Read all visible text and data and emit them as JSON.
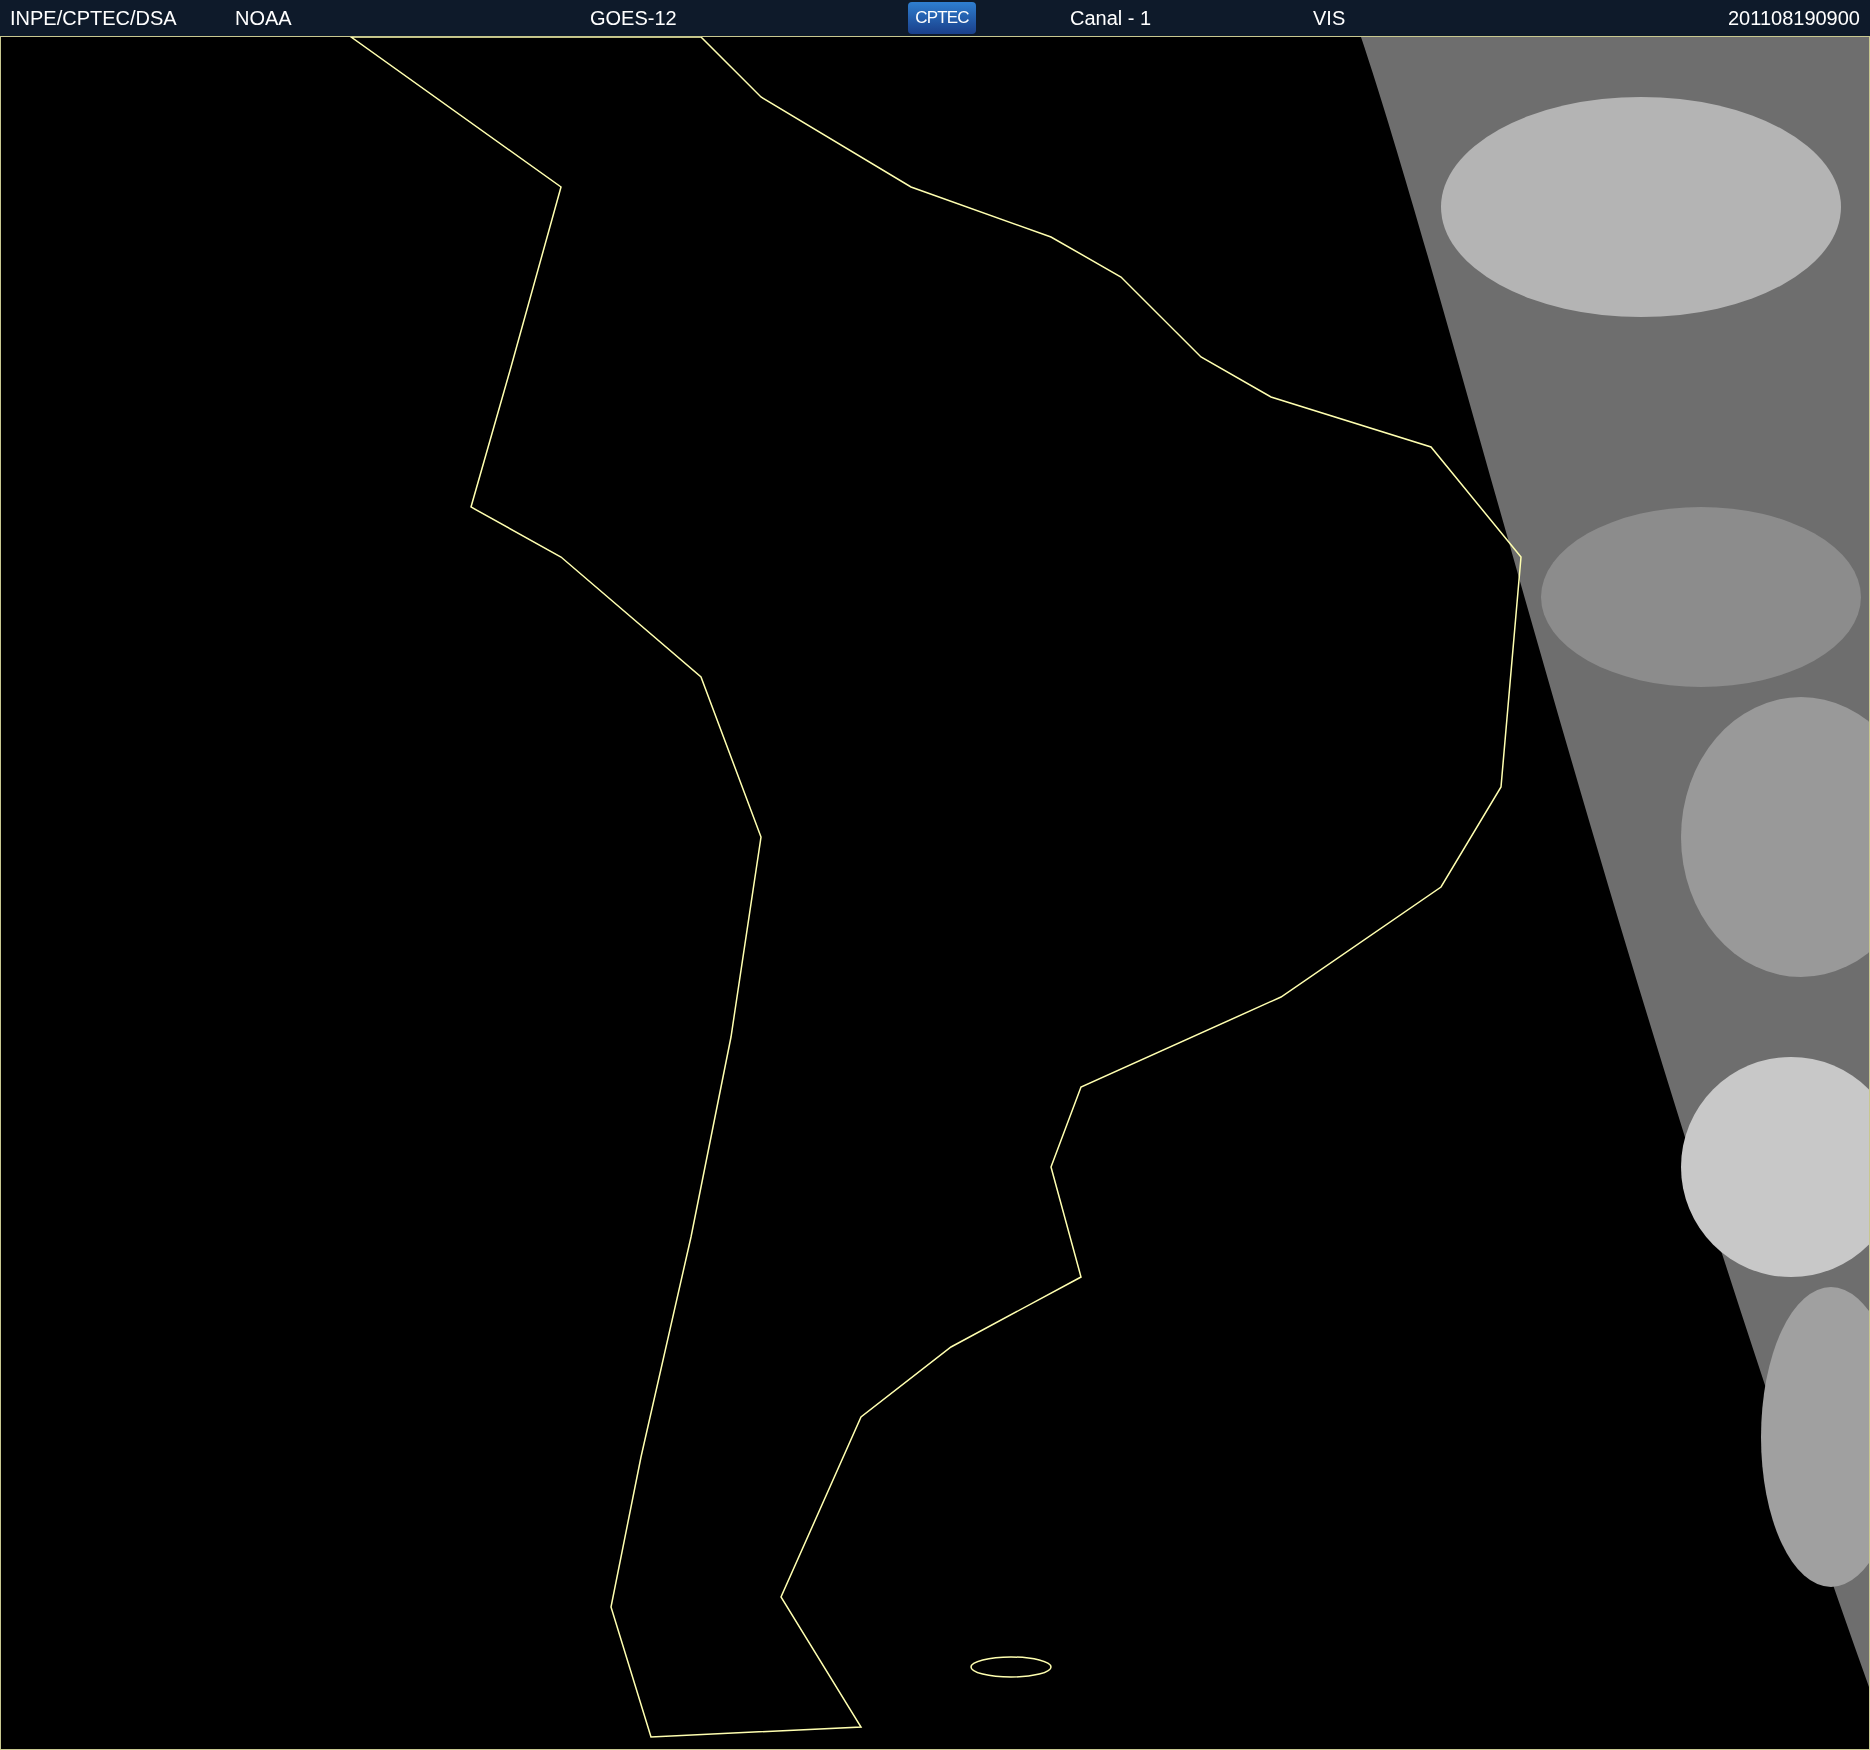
{
  "header": {
    "items": [
      {
        "kind": "text",
        "text": "INPE/CPTEC/DSA"
      },
      {
        "kind": "text",
        "text": "NOAA"
      },
      {
        "kind": "text",
        "text": "GOES-12"
      },
      {
        "kind": "logo",
        "text": "CPTEC"
      },
      {
        "kind": "text",
        "text": "Canal - 1"
      },
      {
        "kind": "text",
        "text": "VIS"
      },
      {
        "kind": "text",
        "text": "201108190900"
      }
    ]
  }
}
